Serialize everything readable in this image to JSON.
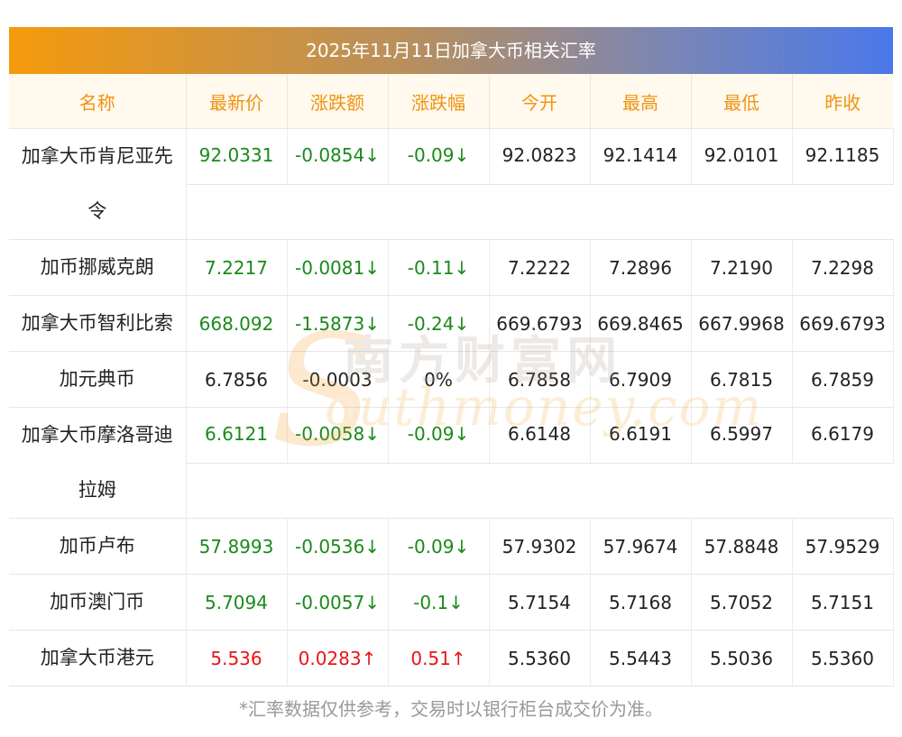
{
  "title": "2025年11月11日加拿大币相关汇率",
  "headers": [
    "名称",
    "最新价",
    "涨跌额",
    "涨跌幅",
    "今开",
    "最高",
    "最低",
    "昨收"
  ],
  "rows": [
    {
      "name": "加拿大币肯尼亚先令",
      "latest": "92.0331",
      "change": "-0.0854↓",
      "pct": "-0.09↓",
      "open": "92.0823",
      "high": "92.1414",
      "low": "92.0101",
      "prev": "92.1185",
      "trend": "down"
    },
    {
      "name": "加币挪威克朗",
      "latest": "7.2217",
      "change": "-0.0081↓",
      "pct": "-0.11↓",
      "open": "7.2222",
      "high": "7.2896",
      "low": "7.2190",
      "prev": "7.2298",
      "trend": "down"
    },
    {
      "name": "加拿大币智利比索",
      "latest": "668.092",
      "change": "-1.5873↓",
      "pct": "-0.24↓",
      "open": "669.6793",
      "high": "669.8465",
      "low": "667.9968",
      "prev": "669.6793",
      "trend": "down"
    },
    {
      "name": "加元典币",
      "latest": "6.7856",
      "change": "-0.0003",
      "pct": "0%",
      "open": "6.7858",
      "high": "6.7909",
      "low": "6.7815",
      "prev": "6.7859",
      "trend": "flat"
    },
    {
      "name": "加拿大币摩洛哥迪拉姆",
      "latest": "6.6121",
      "change": "-0.0058↓",
      "pct": "-0.09↓",
      "open": "6.6148",
      "high": "6.6191",
      "low": "6.5997",
      "prev": "6.6179",
      "trend": "down"
    },
    {
      "name": "加币卢布",
      "latest": "57.8993",
      "change": "-0.0536↓",
      "pct": "-0.09↓",
      "open": "57.9302",
      "high": "57.9674",
      "low": "57.8848",
      "prev": "57.9529",
      "trend": "down"
    },
    {
      "name": "加币澳门币",
      "latest": "5.7094",
      "change": "-0.0057↓",
      "pct": "-0.1↓",
      "open": "5.7154",
      "high": "5.7168",
      "low": "5.7052",
      "prev": "5.7151",
      "trend": "down"
    },
    {
      "name": "加拿大币港元",
      "latest": "5.536",
      "change": "0.0283↑",
      "pct": "0.51↑",
      "open": "5.5360",
      "high": "5.5443",
      "low": "5.5036",
      "prev": "5.5360",
      "trend": "up"
    }
  ],
  "watermark": {
    "cn": "南方财富网",
    "en": "outhmoney.com",
    "initial": "S"
  },
  "footnote": "*汇率数据仅供参考，交易时以银行柜台成交价为准。",
  "colors": {
    "up": "#e8141a",
    "down": "#1a8a1a",
    "header_text": "#f0930f"
  }
}
